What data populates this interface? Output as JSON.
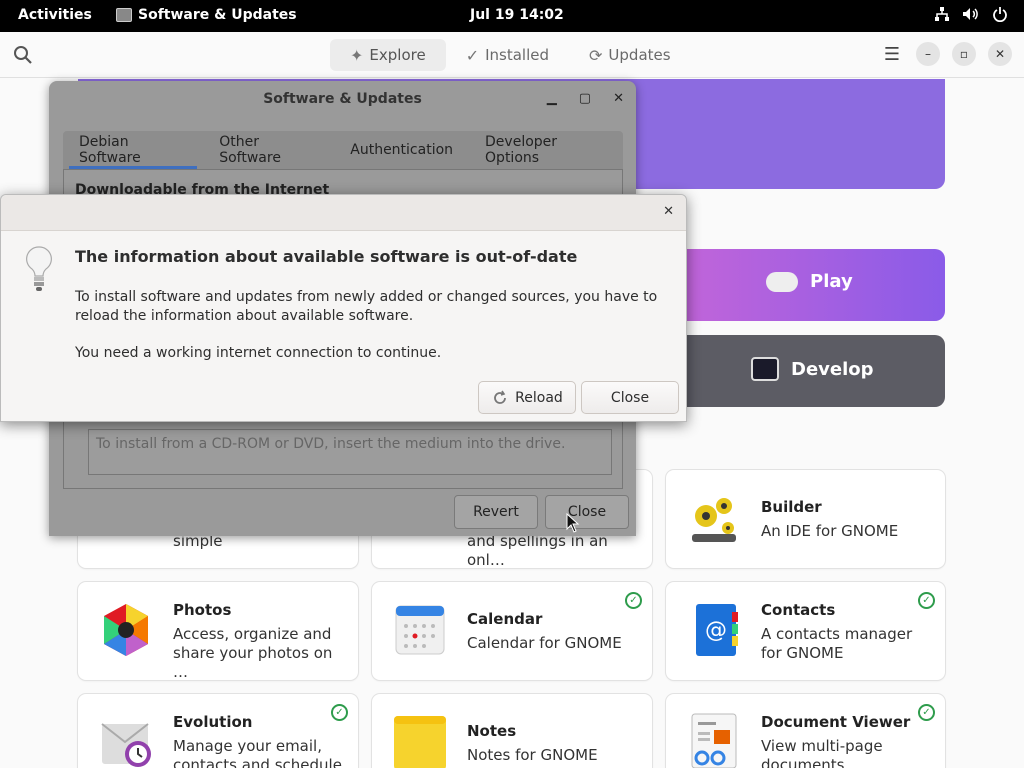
{
  "topbar": {
    "activities": "Activities",
    "app_name": "Software & Updates",
    "clock": "Jul 19  14:02"
  },
  "gs_header": {
    "tabs": [
      {
        "label": "Explore",
        "icon": "explore-icon",
        "active": true
      },
      {
        "label": "Installed",
        "icon": "installed-icon",
        "active": false
      },
      {
        "label": "Updates",
        "icon": "updates-icon",
        "active": false
      }
    ]
  },
  "categories": {
    "play": "Play",
    "develop": "Develop"
  },
  "apps": {
    "partial1_desc": "simple",
    "partial2_desc": "and spellings in an onl…",
    "builder": {
      "name": "Builder",
      "desc": "An IDE for GNOME"
    },
    "photos": {
      "name": "Photos",
      "desc": "Access, organize and share your photos on …"
    },
    "calendar": {
      "name": "Calendar",
      "desc": "Calendar for GNOME"
    },
    "contacts": {
      "name": "Contacts",
      "desc": "A contacts manager for GNOME"
    },
    "evolution": {
      "name": "Evolution",
      "desc": "Manage your email, contacts and schedule"
    },
    "notes": {
      "name": "Notes",
      "desc": "Notes for GNOME"
    },
    "docviewer": {
      "name": "Document Viewer",
      "desc": "View multi-page documents"
    }
  },
  "su_window": {
    "title": "Software & Updates",
    "tabs": [
      "Debian Software",
      "Other Software",
      "Authentication",
      "Developer Options"
    ],
    "section": "Downloadable from the Internet",
    "cd_hint": "To install from a CD-ROM or DVD, insert the medium into the drive.",
    "revert": "Revert",
    "close": "Close"
  },
  "dialog": {
    "heading": "The information about available software is out-of-date",
    "p1": "To install software and updates from newly added or changed sources, you have to reload the information about available software.",
    "p2": "You need a working internet connection to continue.",
    "reload": "Reload",
    "close": "Close"
  },
  "colors": {
    "purple_banner": "#8c6be0",
    "develop": "#5c5c64",
    "check_green": "#2e9c4c",
    "tab_underline": "#3f6fbf"
  }
}
